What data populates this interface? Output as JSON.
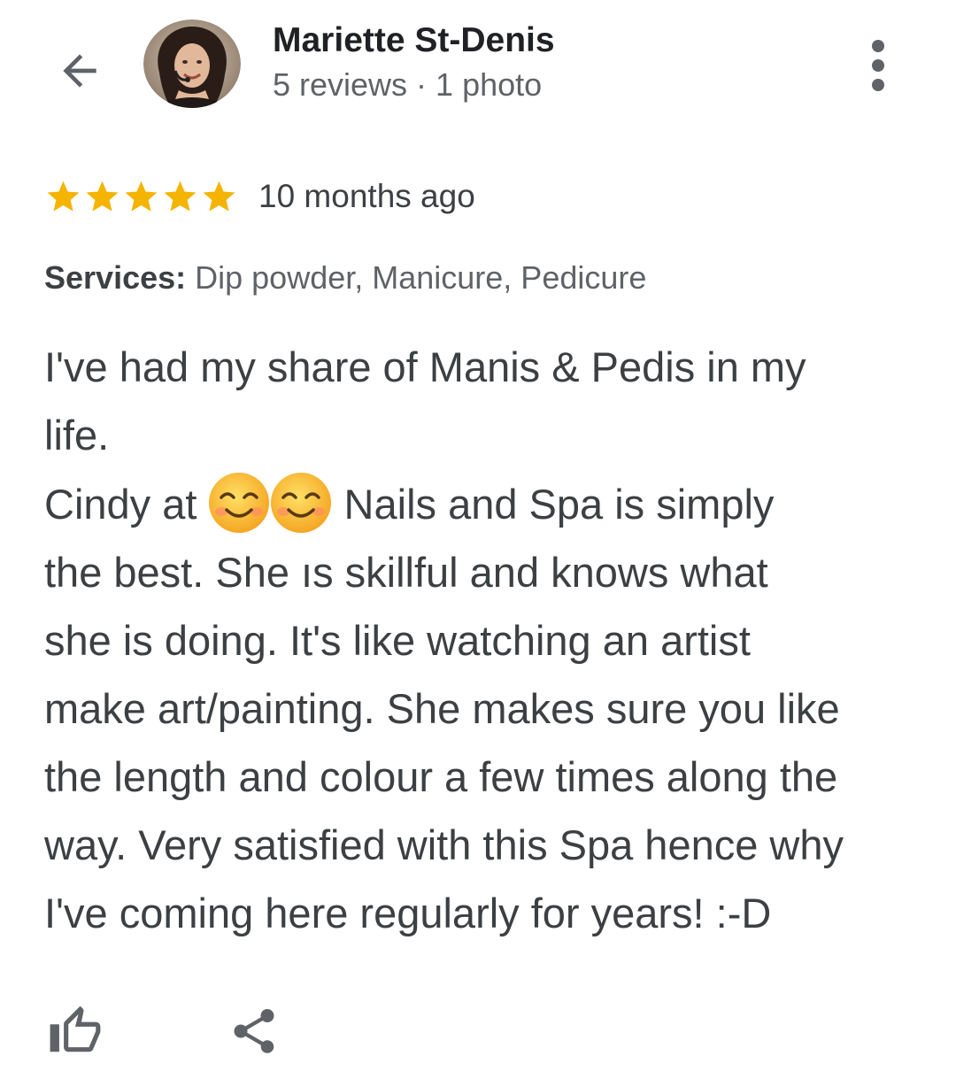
{
  "colors": {
    "star": "#f4b400",
    "text_primary": "#202124",
    "text_body": "#3c4043",
    "text_secondary": "#5f6368",
    "icon": "#5f6368"
  },
  "header": {
    "back_icon": "arrow-left-icon",
    "reviewer_name": "Mariette St-Denis",
    "reviewer_meta": "5 reviews · 1 photo",
    "more_icon": "more-vert-icon"
  },
  "rating": {
    "stars": 5,
    "max_stars": 5,
    "time_ago": "10 months ago"
  },
  "services": {
    "label": "Services:",
    "value": " Dip powder, Manicure, Pedicure"
  },
  "review": {
    "line1": "I've had my share of Manis & Pedis in my",
    "line2": "life.",
    "line3_before": "Cindy at ",
    "line3_emoji": "smiling-face-emoji",
    "line3_after": " Nails and Spa is simply",
    "line4": "the best. She ıs skillful and knows what",
    "line5": "she is doing. It's like watching an artist",
    "line6": "make art/painting. She makes sure you like",
    "line7": "the length and colour a few times along the",
    "line8": "way. Very satisfied with this Spa hence why",
    "line9": "I've coming here regularly for years! :-D"
  },
  "actions": {
    "like_icon": "thumbs-up-icon",
    "share_icon": "share-icon"
  }
}
